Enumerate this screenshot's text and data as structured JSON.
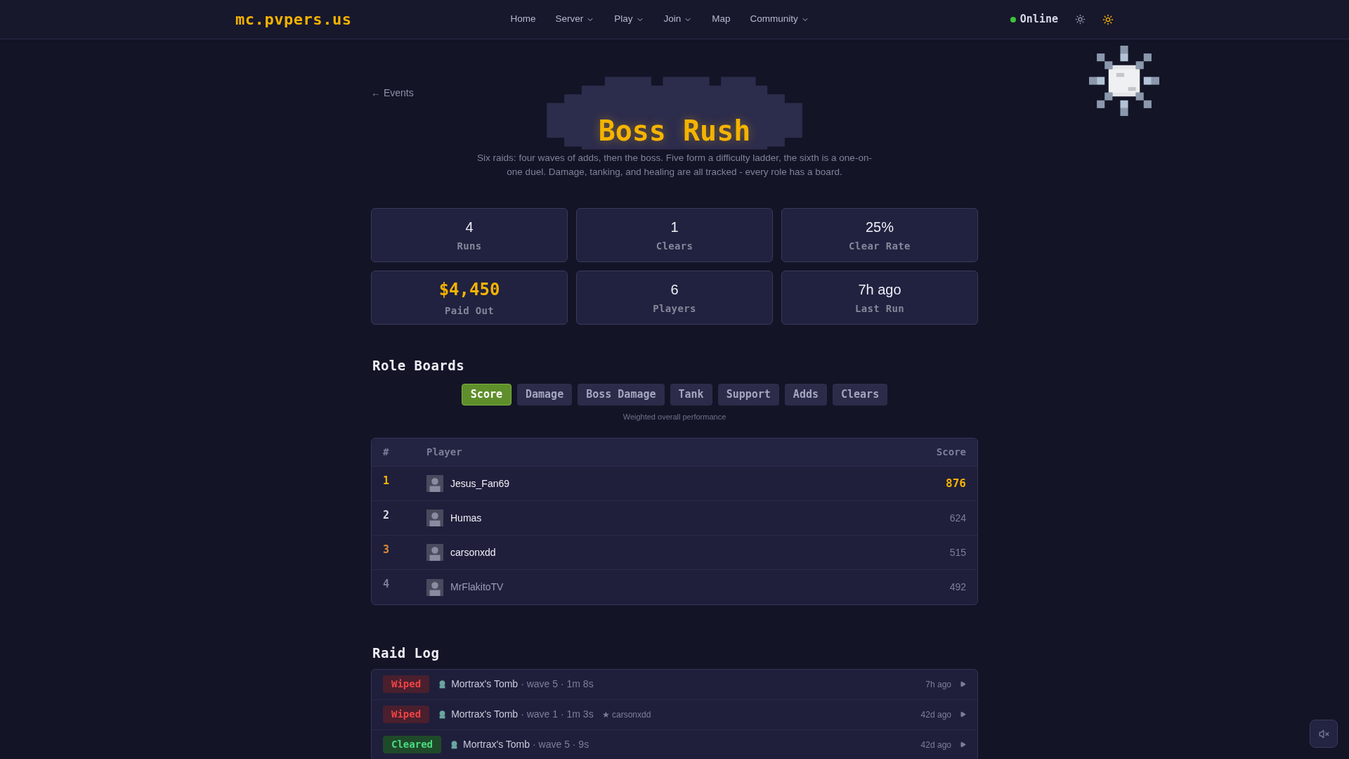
{
  "nav": {
    "logo": "mc.pvpers.us",
    "links": [
      {
        "label": "Home",
        "dropdown": false
      },
      {
        "label": "Server",
        "dropdown": true
      },
      {
        "label": "Play",
        "dropdown": true
      },
      {
        "label": "Join",
        "dropdown": true
      },
      {
        "label": "Map",
        "dropdown": false
      },
      {
        "label": "Community",
        "dropdown": true
      }
    ],
    "status": {
      "label": "Online",
      "online": true
    }
  },
  "back_link": "← Events",
  "title": "Boss Rush",
  "description": "Six raids: four waves of adds, then the boss. Five form a difficulty ladder, the sixth is a one-on-one duel. Damage, tanking, and healing are all tracked - every role has a board.",
  "stats": [
    {
      "value": "4",
      "label": "Runs",
      "highlight": false
    },
    {
      "value": "1",
      "label": "Clears",
      "highlight": false
    },
    {
      "value": "25%",
      "label": "Clear Rate",
      "highlight": false
    },
    {
      "value": "$4,450",
      "label": "Paid Out",
      "highlight": true
    },
    {
      "value": "6",
      "label": "Players",
      "highlight": false
    },
    {
      "value": "7h ago",
      "label": "Last Run",
      "highlight": false
    }
  ],
  "role_boards": {
    "heading": "Role Boards",
    "tabs": [
      {
        "label": "Score",
        "selected": true
      },
      {
        "label": "Damage",
        "selected": false
      },
      {
        "label": "Boss Damage",
        "selected": false
      },
      {
        "label": "Tank",
        "selected": false
      },
      {
        "label": "Support",
        "selected": false
      },
      {
        "label": "Adds",
        "selected": false
      },
      {
        "label": "Clears",
        "selected": false
      }
    ],
    "caption": "Weighted overall performance",
    "table": {
      "columns": [
        "#",
        "Player",
        "Score"
      ],
      "rows": [
        {
          "rank": "1",
          "color": "#f5b301",
          "player": "Jesus_Fan69",
          "score": "876",
          "highlight": true,
          "dimmed": false
        },
        {
          "rank": "2",
          "color": "#d9dbe8",
          "player": "Humas",
          "score": "624",
          "highlight": false,
          "dimmed": false
        },
        {
          "rank": "3",
          "color": "#d98a3a",
          "player": "carsonxdd",
          "score": "515",
          "highlight": false,
          "dimmed": false
        },
        {
          "rank": "4",
          "color": "#7a7d96",
          "player": "MrFlakitoTV",
          "score": "492",
          "highlight": false,
          "dimmed": true
        }
      ]
    }
  },
  "raid_log": {
    "heading": "Raid Log",
    "entries": [
      {
        "status": "Wiped",
        "kind": "wiped",
        "raid": "Mortrax's Tomb",
        "detail": "· wave 5 · 1m 8s",
        "time": "7h ago"
      },
      {
        "status": "Wiped",
        "kind": "wiped",
        "raid": "Mortrax's Tomb",
        "detail": "· wave 1 · 1m 3s",
        "mvp": "★ carsonxdd",
        "time": "42d ago"
      },
      {
        "status": "Cleared",
        "kind": "cleared",
        "raid": "Mortrax's Tomb",
        "detail": "· wave 5 · 9s",
        "time": "42d ago"
      }
    ]
  }
}
